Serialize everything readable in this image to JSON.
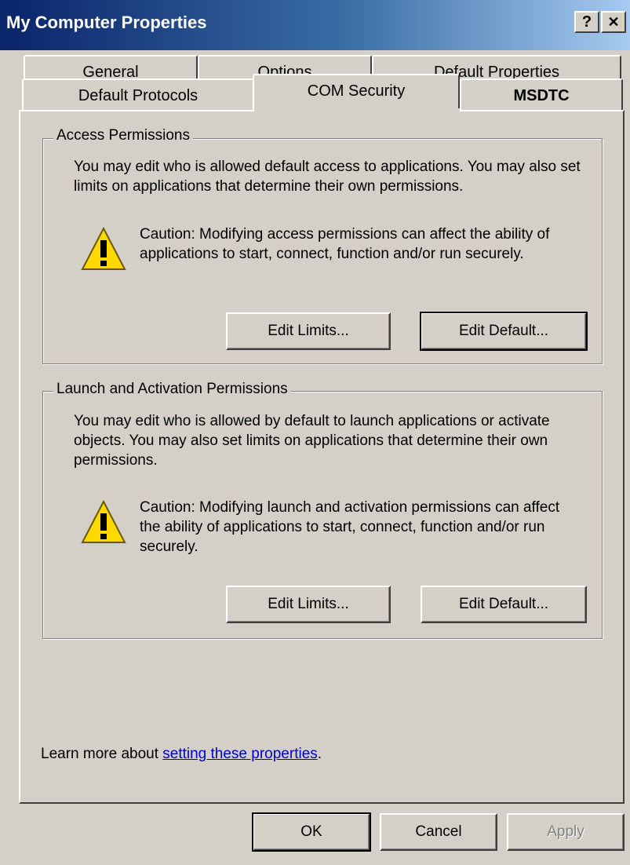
{
  "window": {
    "title": "My Computer Properties",
    "help_label": "?",
    "close_label": "✕"
  },
  "tabs": {
    "row1": [
      {
        "label": "General"
      },
      {
        "label": "Options"
      },
      {
        "label": "Default Properties"
      }
    ],
    "row2": [
      {
        "label": "Default Protocols"
      },
      {
        "label": "COM Security",
        "active": true
      },
      {
        "label": "MSDTC"
      }
    ]
  },
  "access": {
    "legend": "Access Permissions",
    "description": "You may edit who is allowed default access to applications. You may also set limits on applications that determine their own permissions.",
    "caution": "Caution: Modifying access permissions can affect the ability of applications to start, connect, function and/or run securely.",
    "edit_limits": "Edit Limits...",
    "edit_default": "Edit Default..."
  },
  "launch": {
    "legend": "Launch and Activation Permissions",
    "description": "You may edit who is allowed by default to launch applications or activate objects. You may also set limits on applications that determine their own permissions.",
    "caution": "Caution: Modifying launch and activation permissions can affect the ability of applications to start, connect, function and/or run securely.",
    "edit_limits": "Edit Limits...",
    "edit_default": "Edit Default..."
  },
  "footer": {
    "learn_prefix": "Learn more about ",
    "learn_link": "setting these properties",
    "learn_suffix": "."
  },
  "buttons": {
    "ok": "OK",
    "cancel": "Cancel",
    "apply": "Apply"
  },
  "colors": {
    "face": "#d4d0c8",
    "title_start": "#0a246a",
    "title_end": "#a6caf0",
    "link": "#0000cc",
    "warning": "#ffd800"
  },
  "icons": {
    "warning": "warning-triangle-icon"
  }
}
